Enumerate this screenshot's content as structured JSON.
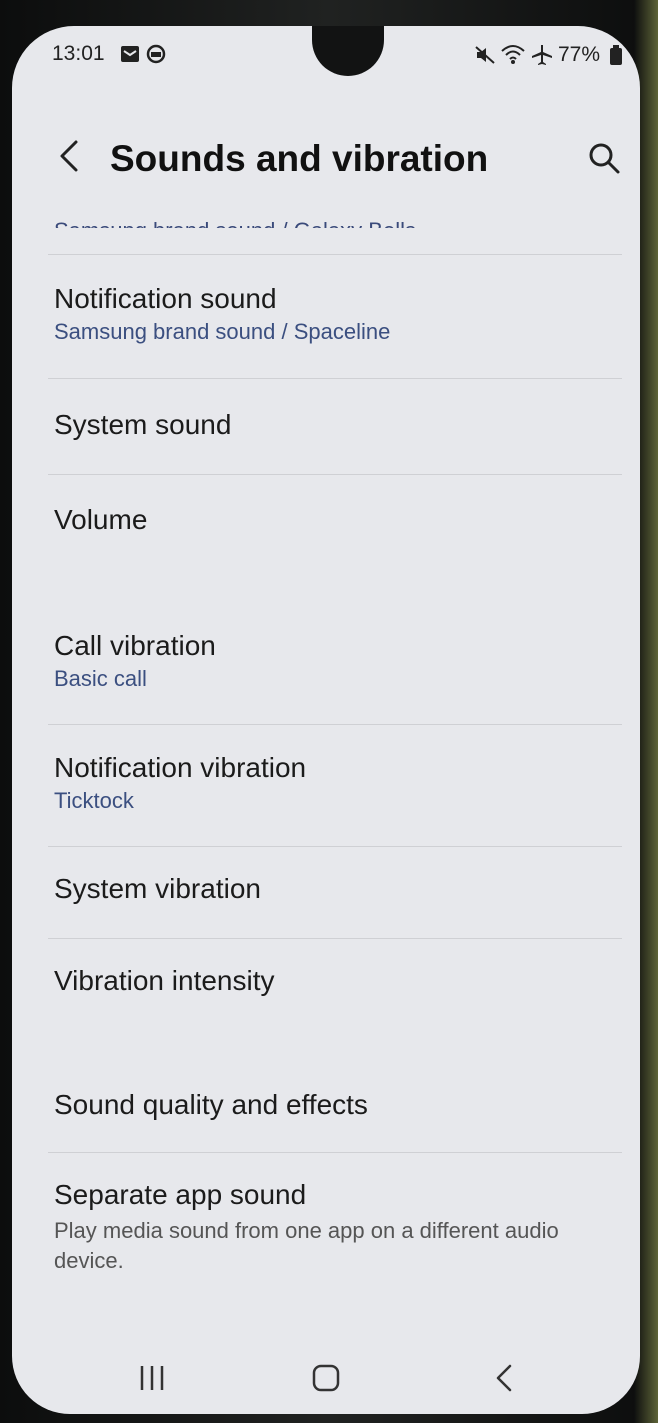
{
  "status_bar": {
    "time": "13:01",
    "battery": "77%",
    "icons": [
      "message-icon",
      "sync-icon",
      "mute-icon",
      "wifi-icon",
      "airplane-icon",
      "battery-icon"
    ]
  },
  "header": {
    "title": "Sounds and vibration",
    "back_icon": "chevron-left-icon",
    "search_icon": "search-icon"
  },
  "clipped_item_subtitle": "Samsung brand sound / Galaxy Bells",
  "items": [
    {
      "title": "Notification sound",
      "subtitle": "Samsung brand sound / Spaceline"
    },
    {
      "title": "System sound"
    },
    {
      "title": "Volume"
    },
    {
      "title": "Call vibration",
      "subtitle": "Basic call"
    },
    {
      "title": "Notification vibration",
      "subtitle": "Ticktock"
    },
    {
      "title": "System vibration"
    },
    {
      "title": "Vibration intensity"
    },
    {
      "title": "Sound quality and effects"
    },
    {
      "title": "Separate app sound",
      "description": "Play media sound from one app on a different audio device."
    }
  ],
  "nav_bar": {
    "icons": [
      "recents-icon",
      "home-icon",
      "back-icon"
    ]
  },
  "colors": {
    "background": "#e7e8ec",
    "subtitle": "#3b4f80",
    "divider": "#cfd0d4"
  }
}
